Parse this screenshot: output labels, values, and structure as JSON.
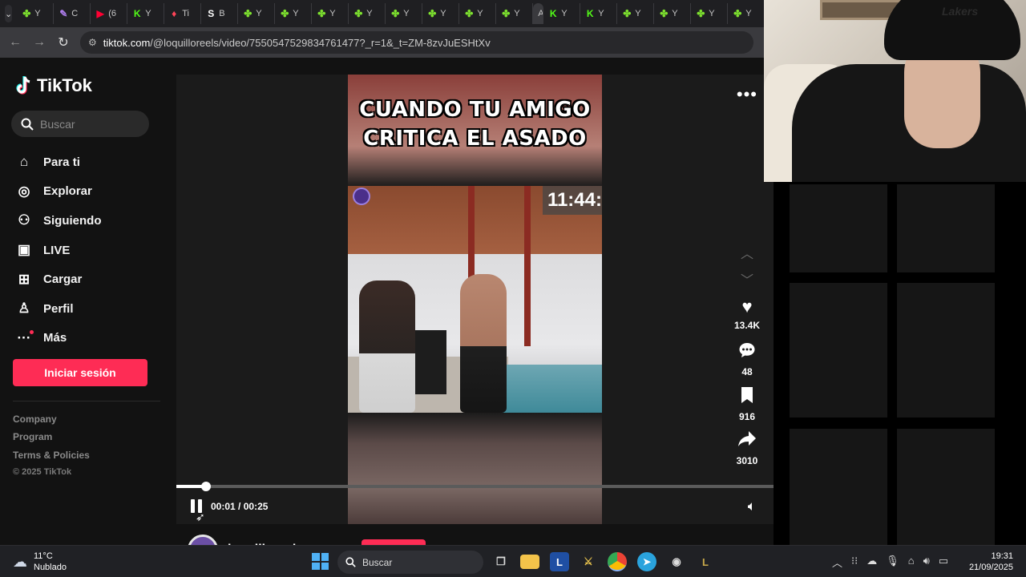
{
  "browser": {
    "tabs": [
      {
        "label": "Y",
        "icon": "green-clover-icon",
        "color": "#7ee22f"
      },
      {
        "label": "C",
        "icon": "feather-icon",
        "color": "#b07ff0"
      },
      {
        "label": "(6",
        "icon": "youtube-icon",
        "color": "#ff0033"
      },
      {
        "label": "Y",
        "icon": "kick-icon",
        "color": "#53fc18"
      },
      {
        "label": "Ti",
        "icon": "tinder-icon",
        "color": "#ff4458"
      },
      {
        "label": "B",
        "icon": "s-logo-icon",
        "color": "#ffffff"
      },
      {
        "label": "Y",
        "icon": "green-clover-icon",
        "color": "#7ee22f"
      },
      {
        "label": "Y",
        "icon": "green-clover-icon",
        "color": "#7ee22f"
      },
      {
        "label": "Y",
        "icon": "green-clover-icon",
        "color": "#7ee22f"
      },
      {
        "label": "Y",
        "icon": "green-clover-icon",
        "color": "#7ee22f"
      },
      {
        "label": "Y",
        "icon": "green-clover-icon",
        "color": "#7ee22f"
      },
      {
        "label": "Y",
        "icon": "green-clover-icon",
        "color": "#7ee22f"
      },
      {
        "label": "Y",
        "icon": "green-clover-icon",
        "color": "#7ee22f"
      },
      {
        "label": "Y",
        "icon": "green-clover-icon",
        "color": "#7ee22f"
      }
    ],
    "active_tab": {
      "label": "A",
      "close": "✕"
    },
    "tabs_after": [
      {
        "label": "Y",
        "icon": "kick-icon",
        "color": "#53fc18"
      },
      {
        "label": "Y",
        "icon": "kick-icon",
        "color": "#53fc18"
      },
      {
        "label": "Y",
        "icon": "green-clover-icon",
        "color": "#7ee22f"
      },
      {
        "label": "Y",
        "icon": "green-clover-icon",
        "color": "#7ee22f"
      },
      {
        "label": "Y",
        "icon": "green-clover-icon",
        "color": "#7ee22f"
      },
      {
        "label": "Y",
        "icon": "green-clover-icon",
        "color": "#7ee22f"
      }
    ],
    "url_host": "tiktok.com",
    "url_path": "/@loquilloreels/video/7550547529834761477?_r=1&_t=ZM-8zvJuESHtXv"
  },
  "sidebar": {
    "brand": "TikTok",
    "search_placeholder": "Buscar",
    "nav": [
      {
        "label": "Para ti",
        "icon": "home-icon"
      },
      {
        "label": "Explorar",
        "icon": "compass-icon"
      },
      {
        "label": "Siguiendo",
        "icon": "following-icon"
      },
      {
        "label": "LIVE",
        "icon": "live-icon"
      },
      {
        "label": "Cargar",
        "icon": "upload-icon"
      },
      {
        "label": "Perfil",
        "icon": "profile-icon"
      },
      {
        "label": "Más",
        "icon": "more-icon"
      }
    ],
    "login": "Iniciar sesión",
    "footer": [
      "Company",
      "Program",
      "Terms & Policies"
    ],
    "copyright": "© 2025 TikTok"
  },
  "video": {
    "title_line1": "CUANDO TU AMIGO",
    "title_line2": "CRITICA EL ASADO",
    "overlay_clock": "11:44:",
    "current_time": "00:01",
    "separator": " / ",
    "duration": "00:25",
    "progress_fraction": 0.05,
    "author": "loquilloreels"
  },
  "actions": {
    "likes": "13.4K",
    "comments": "48",
    "saves": "916",
    "shares": "3010"
  },
  "taskbar": {
    "temperature": "11°C",
    "condition": "Nublado",
    "search_label": "Buscar",
    "time": "19:31",
    "date": "21/09/2025"
  },
  "colors": {
    "brand_accent": "#fe2c55",
    "page_bg": "#121212",
    "windows_blue": "#4fb1f5"
  }
}
